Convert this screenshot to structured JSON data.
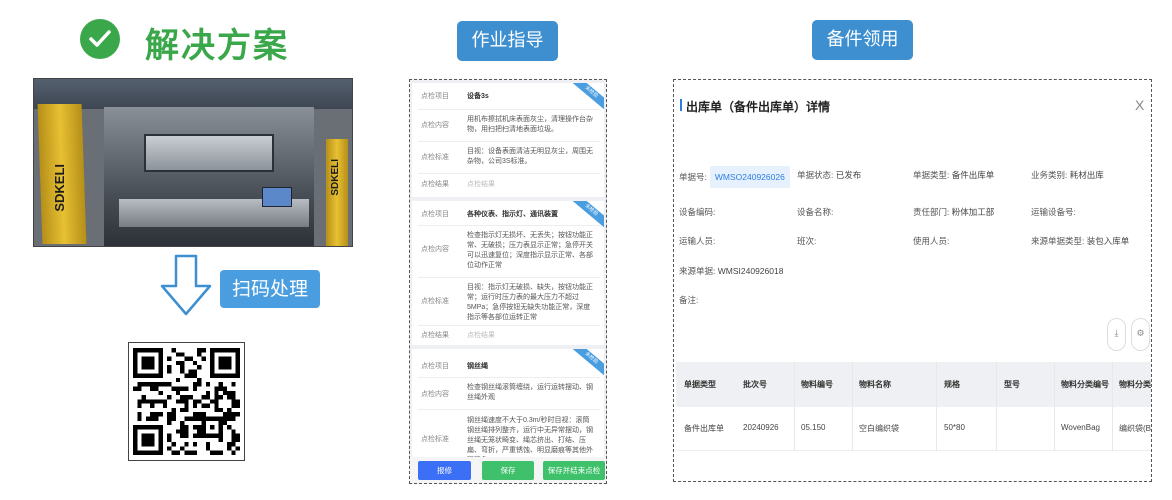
{
  "solution": {
    "title": "解决方案"
  },
  "photo": {
    "brand_left": "SDKELI",
    "brand_right": "SDKELI"
  },
  "scan": {
    "label": "扫码处理"
  },
  "tags": {
    "work_instruction": "作业指导",
    "parts_requisition": "备件领用"
  },
  "checklist": {
    "ribbon": "未检验",
    "labels": {
      "item": "点检项目",
      "content": "点检内容",
      "standard": "点检标准",
      "result": "点检结果"
    },
    "result_placeholder": "点检结果",
    "cards": [
      {
        "item": "设备3s",
        "content": "用机布擦拭机床表面灰尘，清理操作台杂物，用扫把扫清地表面垃圾。",
        "standard": "目视：设备表面清洁无明显灰尘，周围无杂物，公司3S标准。"
      },
      {
        "item": "各种仪表、指示灯、通讯装置",
        "content": "检查指示灯无损坏、无丢失；按钮功能正常、无破损；压力表显示正常；急停开关可以迅速复位；深度指示显示正常、各部位动作正常",
        "standard": "目视：指示灯无破损、缺失，按钮功能正常；运行时压力表的最大压力不超过5MPa；急停按钮无缺失功能正常，深度指示等各部位运转正常"
      },
      {
        "item": "钢丝绳",
        "content": "检查钢丝绳滚筒缠绕，运行运转摆动、钢丝绳外观",
        "standard": "钢丝绳速度不大于0.3m/秒时目视：滚筒钢丝绳排列整齐，运行中无异常摆动，钢丝绳无笼状畸变、绳芯挤出、打结、压扁、弯折，严重锈蚀、明显磨痕等其他外观现象"
      }
    ],
    "buttons": {
      "report": "报修",
      "save": "保存",
      "save_finish": "保存并结束点检"
    }
  },
  "detail": {
    "title": "出库单（备件出库单）详情",
    "close": "X",
    "fields": {
      "doc_no_label": "单据号:",
      "doc_no": "WMSO240926026",
      "status_label": "单据状态:",
      "status": "已发布",
      "doc_type_label": "单据类型:",
      "doc_type": "备件出库单",
      "biz_type_label": "业务类别:",
      "biz_type": "耗材出库",
      "equip_code_label": "设备编码:",
      "equip_name_label": "设备名称:",
      "dept_label": "责任部门:",
      "dept": "粉体加工部",
      "transport_equip_label": "运输设备号:",
      "transport_person_label": "运输人员:",
      "shift_label": "班次:",
      "user_label": "使用人员:",
      "source_type_label": "来源单据类型:",
      "source_type": "装包入库单",
      "source_no_label": "来源单据:",
      "source_no": "WMSI240926018",
      "remark_label": "备注:"
    },
    "tools": {
      "download_icon": "⤓",
      "settings_icon": "⚙"
    },
    "table": {
      "headers": [
        "单据类型",
        "批次号",
        "物料编号",
        "物料名称",
        "规格",
        "型号",
        "物料分类编号",
        "物料分类"
      ],
      "row": [
        "备件出库单",
        "20240926",
        "05.150",
        "空白编织袋",
        "50*80",
        "",
        "WovenBag",
        "编织袋(B)"
      ]
    }
  }
}
